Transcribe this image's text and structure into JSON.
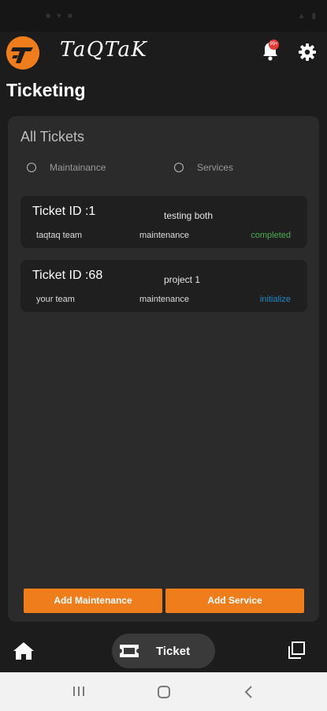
{
  "app": {
    "brand": "TaQTaK"
  },
  "header": {
    "notification_badge": "99+"
  },
  "page": {
    "title": "Ticketing"
  },
  "panel": {
    "title": "All Tickets",
    "filters": [
      {
        "label": "Maintainance"
      },
      {
        "label": "Services"
      }
    ]
  },
  "tickets": [
    {
      "id": "Ticket ID :1",
      "name": "testing both",
      "team": "taqtaq team",
      "type": "maintenance",
      "status": "completed",
      "status_color": "#4caf50"
    },
    {
      "id": "Ticket ID :68",
      "name": "project 1",
      "team": "your team",
      "type": "maintenance",
      "status": "initialize",
      "status_color": "#1e88c8"
    }
  ],
  "actions": {
    "add_maintenance": "Add Maintenance",
    "add_service": "Add Service"
  },
  "bottom_nav": {
    "active_label": "Ticket"
  },
  "colors": {
    "accent": "#ef7d1b",
    "background": "#1c1c1c",
    "panel": "#2b2b2b",
    "card": "#1f1f1f"
  }
}
